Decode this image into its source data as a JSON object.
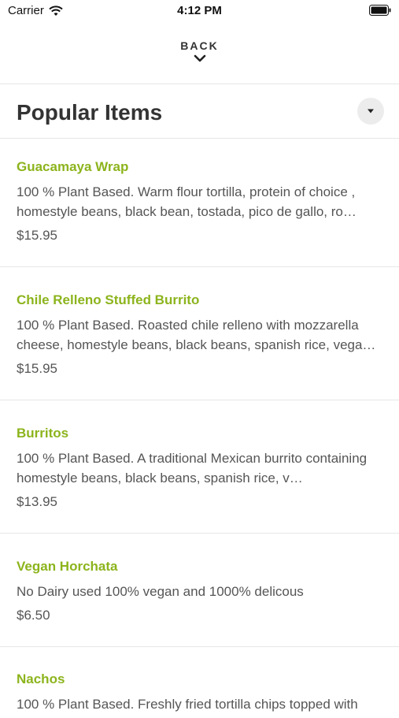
{
  "status_bar": {
    "carrier": "Carrier",
    "time": "4:12 PM"
  },
  "nav": {
    "back_label": "BACK"
  },
  "section": {
    "title": "Popular Items"
  },
  "colors": {
    "accent": "#8cb41c",
    "text": "#333333",
    "muted": "#555555"
  },
  "items": [
    {
      "name": "Guacamaya Wrap",
      "description": "100 % Plant Based. Warm flour tortilla, protein of choice , homestyle beans, black bean,  tostada, pico de gallo, ro…",
      "price": "$15.95"
    },
    {
      "name": "Chile Relleno Stuffed Burrito",
      "description": "100 % Plant Based. Roasted chile relleno with mozzarella cheese, homestyle beans, black beans, spanish rice, vega…",
      "price": "$15.95"
    },
    {
      "name": "Burritos",
      "description": "100 % Plant Based. A traditional Mexican burrito containing homestyle beans, black beans, spanish rice, v…",
      "price": "$13.95"
    },
    {
      "name": "Vegan Horchata",
      "description": "No Dairy used 100% vegan and 1000% delicous",
      "price": "$6.50"
    },
    {
      "name": "Nachos",
      "description": "100 % Plant Based. Freshly fried tortilla chips topped with",
      "price": ""
    }
  ]
}
